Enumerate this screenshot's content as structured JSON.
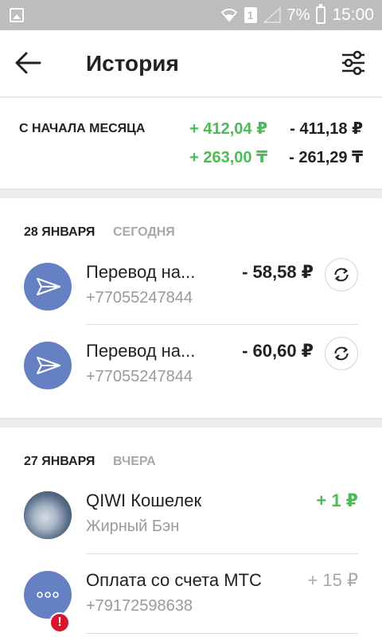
{
  "statusbar": {
    "battery_pct": "7%",
    "time": "15:00",
    "sim_slot": "1"
  },
  "header": {
    "title": "История",
    "back_icon": "arrow-left-icon",
    "filter_icon": "sliders-icon"
  },
  "summary": {
    "label": "С НАЧАЛА МЕСЯЦА",
    "rub_in": "+ 412,04 ₽",
    "rub_out": "- 411,18 ₽",
    "kzt_in": "+ 263,00 ₸",
    "kzt_out": "- 261,29 ₸"
  },
  "days": [
    {
      "date": "28 ЯНВАРЯ",
      "relative": "СЕГОДНЯ",
      "transactions": [
        {
          "title": "Перевод на...",
          "subtitle": "+77055247844",
          "amount": "- 58,58 ₽"
        },
        {
          "title": "Перевод на...",
          "subtitle": "+77055247844",
          "amount": "- 60,60 ₽"
        }
      ]
    },
    {
      "date": "27 ЯНВАРЯ",
      "relative": "ВЧЕРА",
      "transactions": [
        {
          "title": "QIWI Кошелек",
          "subtitle": "Жирный Бэн",
          "amount": "+ 1 ₽"
        },
        {
          "title": "Оплата со счета МТС",
          "subtitle": "+79172598638",
          "amount": "+ 15 ₽",
          "badge": "!"
        }
      ]
    }
  ],
  "colors": {
    "income": "#4cbb58",
    "avatar_bg": "#6680c4",
    "status_bar": "#bdbdbd",
    "error": "#d9142f"
  }
}
